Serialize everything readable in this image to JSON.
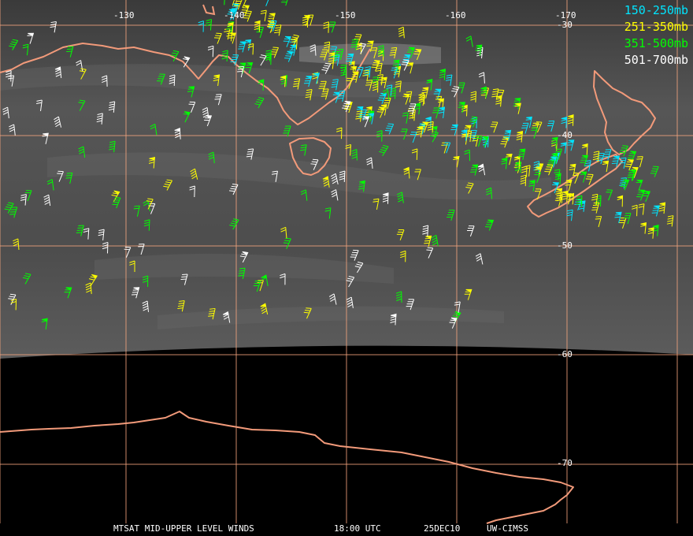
{
  "colors": {
    "grid": "#f0a27c",
    "coast": "#f29a7a",
    "ocean_base": "#4b4b4b",
    "space": "#000000",
    "label": "#ffffff"
  },
  "grid": {
    "longitude_labels": [
      "-130",
      "-140",
      "-150",
      "-160",
      "-170"
    ],
    "latitude_labels": [
      "-30",
      "-40",
      "-50",
      "-60",
      "-70"
    ]
  },
  "legend": [
    {
      "label": "150-250mb",
      "color": "#00e5ff"
    },
    {
      "label": "251-350mb",
      "color": "#ffff00"
    },
    {
      "label": "351-500mb",
      "color": "#00ff00"
    },
    {
      "label": "501-700mb",
      "color": "#ffffff"
    }
  ],
  "footer": {
    "product": "MTSAT MID-UPPER LEVEL WINDS",
    "time": "18:00 UTC",
    "date": "25DEC10",
    "source": "UW-CIMSS"
  }
}
